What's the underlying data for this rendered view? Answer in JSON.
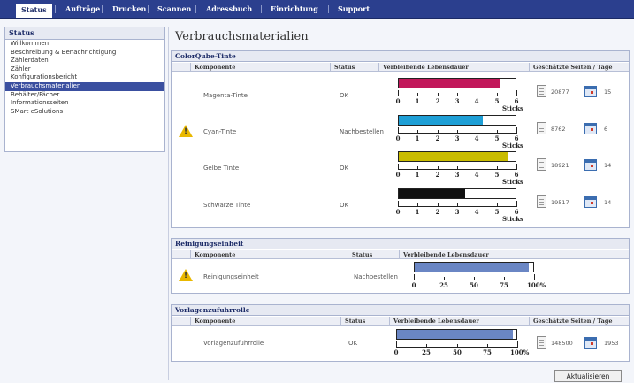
{
  "topnav": {
    "tabs": [
      "Status",
      "Aufträge",
      "Drucken",
      "Scannen",
      "Adressbuch",
      "Einrichtung",
      "Support"
    ],
    "active": "Status"
  },
  "sidebar": {
    "title": "Status",
    "items": [
      "Willkommen",
      "Beschreibung & Benachrichtigung",
      "Zählerdaten",
      "Zähler",
      "Konfigurationsbericht",
      "Verbrauchsmaterialien",
      "Behälter/Fächer",
      "Informationsseiten",
      "SMart eSolutions"
    ],
    "active_item": "Verbrauchsmaterialien"
  },
  "page_title": "Verbrauchsmaterialien",
  "ink_panel": {
    "title": "ColorQube-Tinte",
    "headers": [
      "Komponente",
      "Status",
      "Verbleibende Lebensdauer",
      "Geschätzte Seiten / Tage"
    ],
    "scale_labels": [
      "0",
      "1",
      "2",
      "3",
      "4",
      "5",
      "6"
    ],
    "scale_unit": "Sticks",
    "rows": [
      {
        "warning": false,
        "component": "Magenta-Tinte",
        "status": "OK",
        "remaining_sticks": 5.2,
        "max_sticks": 6,
        "color": "#c2185b",
        "pages": "20877",
        "days": "15"
      },
      {
        "warning": true,
        "component": "Cyan-Tinte",
        "status": "Nachbestellen",
        "remaining_sticks": 4.3,
        "max_sticks": 6,
        "color": "#1e9fd6",
        "pages": "8762",
        "days": "6"
      },
      {
        "warning": false,
        "component": "Gelbe Tinte",
        "status": "OK",
        "remaining_sticks": 5.6,
        "max_sticks": 6,
        "color": "#c9bc00",
        "pages": "18921",
        "days": "14"
      },
      {
        "warning": false,
        "component": "Schwarze Tinte",
        "status": "OK",
        "remaining_sticks": 3.4,
        "max_sticks": 6,
        "color": "#111111",
        "pages": "19517",
        "days": "14"
      }
    ]
  },
  "cleaning_panel": {
    "title": "Reinigungseinheit",
    "headers": [
      "Komponente",
      "Status",
      "Verbleibende Lebensdauer"
    ],
    "scale_labels": [
      "0",
      "25",
      "50",
      "75",
      "100%"
    ],
    "row": {
      "warning": true,
      "component": "Reinigungseinheit",
      "status": "Nachbestellen",
      "remaining_percent": 96,
      "color": "#6a86c4"
    }
  },
  "roller_panel": {
    "title": "Vorlagenzufuhrrolle",
    "headers": [
      "Komponente",
      "Status",
      "Verbleibende Lebensdauer",
      "Geschätzte Seiten / Tage"
    ],
    "scale_labels": [
      "0",
      "25",
      "50",
      "75",
      "100%"
    ],
    "row": {
      "warning": false,
      "component": "Vorlagenzufuhrrolle",
      "status": "OK",
      "remaining_percent": 97,
      "color": "#6a86c4",
      "pages": "148500",
      "days": "1953"
    }
  },
  "refresh_button": "Aktualisieren"
}
